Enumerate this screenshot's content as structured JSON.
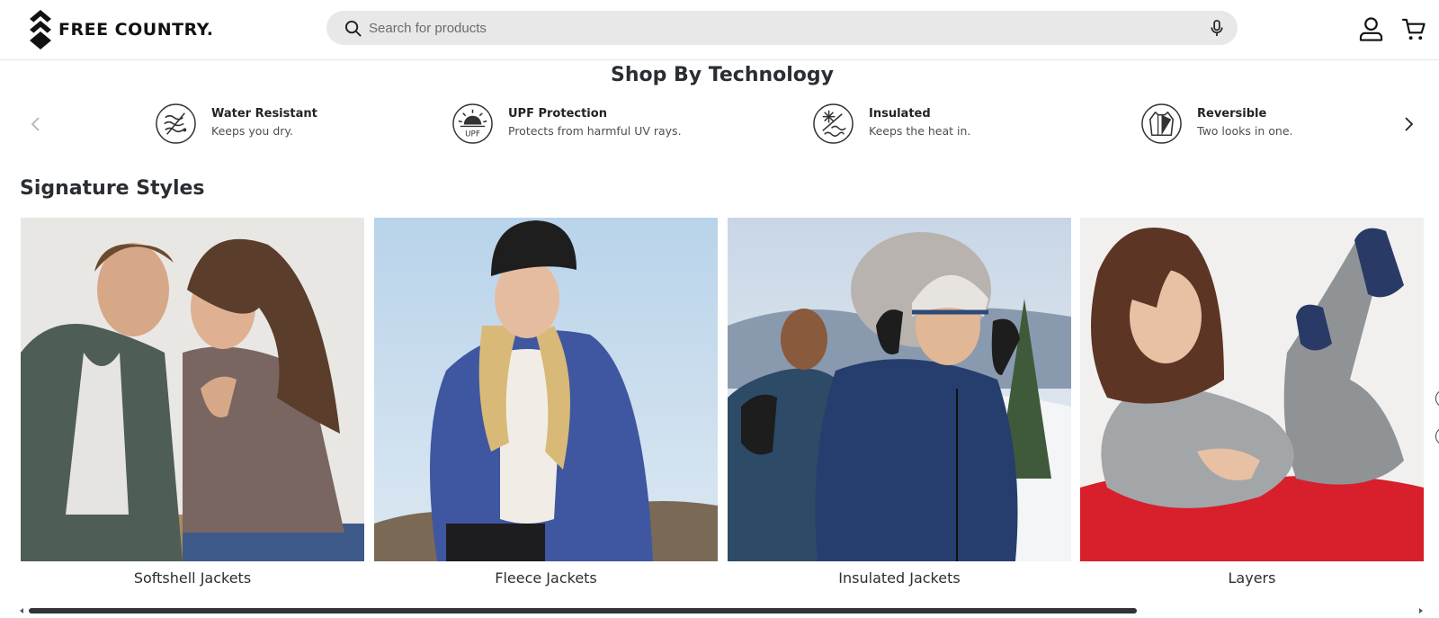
{
  "header": {
    "brand": "FREE COUNTRY.",
    "search": {
      "placeholder": "Search for products",
      "value": ""
    },
    "icons": [
      "search-icon",
      "microphone-icon",
      "account-icon",
      "cart-icon"
    ]
  },
  "technology": {
    "title": "Shop By Technology",
    "items": [
      {
        "name": "Water Resistant",
        "desc": "Keeps you dry.",
        "icon": "water-resistant-icon"
      },
      {
        "name": "UPF Protection",
        "desc": "Protects from harmful UV rays.",
        "icon": "upf-sun-icon",
        "icon_text": "UPF"
      },
      {
        "name": "Insulated",
        "desc": "Keeps the heat in.",
        "icon": "insulated-snowflake-icon"
      },
      {
        "name": "Reversible",
        "desc": "Two looks in one.",
        "icon": "reversible-jacket-icon"
      }
    ]
  },
  "signature": {
    "title": "Signature Styles",
    "cards": [
      {
        "label": "Softshell Jackets"
      },
      {
        "label": "Fleece Jackets"
      },
      {
        "label": "Insulated Jackets"
      },
      {
        "label": "Layers"
      }
    ]
  },
  "scrollbar": {
    "position": 0.0,
    "visible_fraction": 0.8
  },
  "colors": {
    "heading": "#2a2e33",
    "search_bg": "#e8e8e8",
    "scroll_thumb": "#2f3338",
    "text": "#1f2328"
  }
}
